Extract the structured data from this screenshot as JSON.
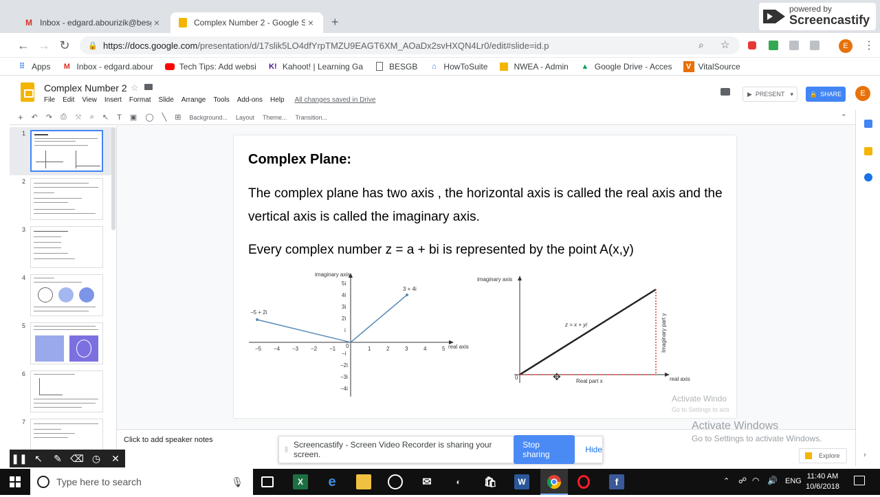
{
  "browser": {
    "tabs": [
      {
        "title": "Inbox - edgard.abourizik@besgb",
        "icon": "gmail-icon"
      },
      {
        "title": "Complex Number 2 - Google Slid",
        "icon": "slides-icon"
      }
    ],
    "new_tab": "+",
    "url_host": "https://docs.google.com",
    "url_path": "/presentation/d/17slik5LO4dfYrpTMZU9EAGT6XM_AOaDx2svHXQN4Lr0/edit#slide=id.p",
    "profile_letter": "E",
    "bookmarks": [
      {
        "label": "Apps",
        "icon": "apps-icon"
      },
      {
        "label": "Inbox - edgard.abour",
        "icon": "gmail-icon"
      },
      {
        "label": "Tech Tips: Add websi",
        "icon": "youtube-icon"
      },
      {
        "label": "Kahoot! | Learning Ga",
        "icon": "kahoot-icon"
      },
      {
        "label": "BESGB",
        "icon": "page-icon"
      },
      {
        "label": "HowToSuite",
        "icon": "home-icon"
      },
      {
        "label": "NWEA - Admin",
        "icon": "nwea-icon"
      },
      {
        "label": "Google Drive - Acces",
        "icon": "drive-icon"
      },
      {
        "label": "VitalSource",
        "icon": "vitalsource-icon"
      }
    ]
  },
  "watermark": {
    "powered": "powered by",
    "brand": "Screencastify"
  },
  "slides_app": {
    "doc_title": "Complex Number 2",
    "menus": [
      "File",
      "Edit",
      "View",
      "Insert",
      "Format",
      "Slide",
      "Arrange",
      "Tools",
      "Add-ons",
      "Help"
    ],
    "saved_status": "All changes saved in Drive",
    "present_label": "PRESENT",
    "share_label": "SHARE",
    "toolbar": {
      "background": "Background...",
      "layout": "Layout",
      "theme": "Theme...",
      "transition": "Transition..."
    },
    "thumb_numbers": [
      "1",
      "2",
      "3",
      "4",
      "5",
      "6",
      "7"
    ],
    "speaker_notes": "Click to add speaker notes",
    "explore": "Explore"
  },
  "slide": {
    "heading": "Complex Plane:",
    "para1_line1": "The complex plane has two axis , the horizontal axis is called the real axis and the",
    "para1_line2": "vertical axis is called the imaginary axis.",
    "para2": "Every complex number z = a + bi is represented by the point A(x,y)",
    "fig1": {
      "y_label": "imaginary axis",
      "x_label": "real axis",
      "x_ticks": [
        "−5",
        "−4",
        "−3",
        "−2",
        "−1",
        "0",
        "1",
        "2",
        "3",
        "4",
        "5"
      ],
      "y_ticks": [
        "5i",
        "4i",
        "3i",
        "2i",
        "i",
        "−i",
        "−2i",
        "−3i",
        "−4i"
      ],
      "point_a": "−5 + 2i",
      "point_b": "3 + 4i"
    },
    "fig2": {
      "y_label": "imaginary axis",
      "x_label": "real axis",
      "origin": "0",
      "line_label": "z = x + yi",
      "real_part": "Real part x",
      "imag_part": "Imaginary part y"
    },
    "activate_faint": "Activate Windo",
    "activate_faint2": "Go to Settings to acti"
  },
  "share_bar": {
    "message": "Screencastify - Screen Video Recorder is sharing your screen.",
    "stop": "Stop sharing",
    "hide": "Hide"
  },
  "windows": {
    "activate_title": "Activate Windows",
    "activate_sub": "Go to Settings to activate Windows.",
    "search_placeholder": "Type here to search",
    "time": "11:40 AM",
    "date": "10/6/2018",
    "lang": "ENG"
  }
}
